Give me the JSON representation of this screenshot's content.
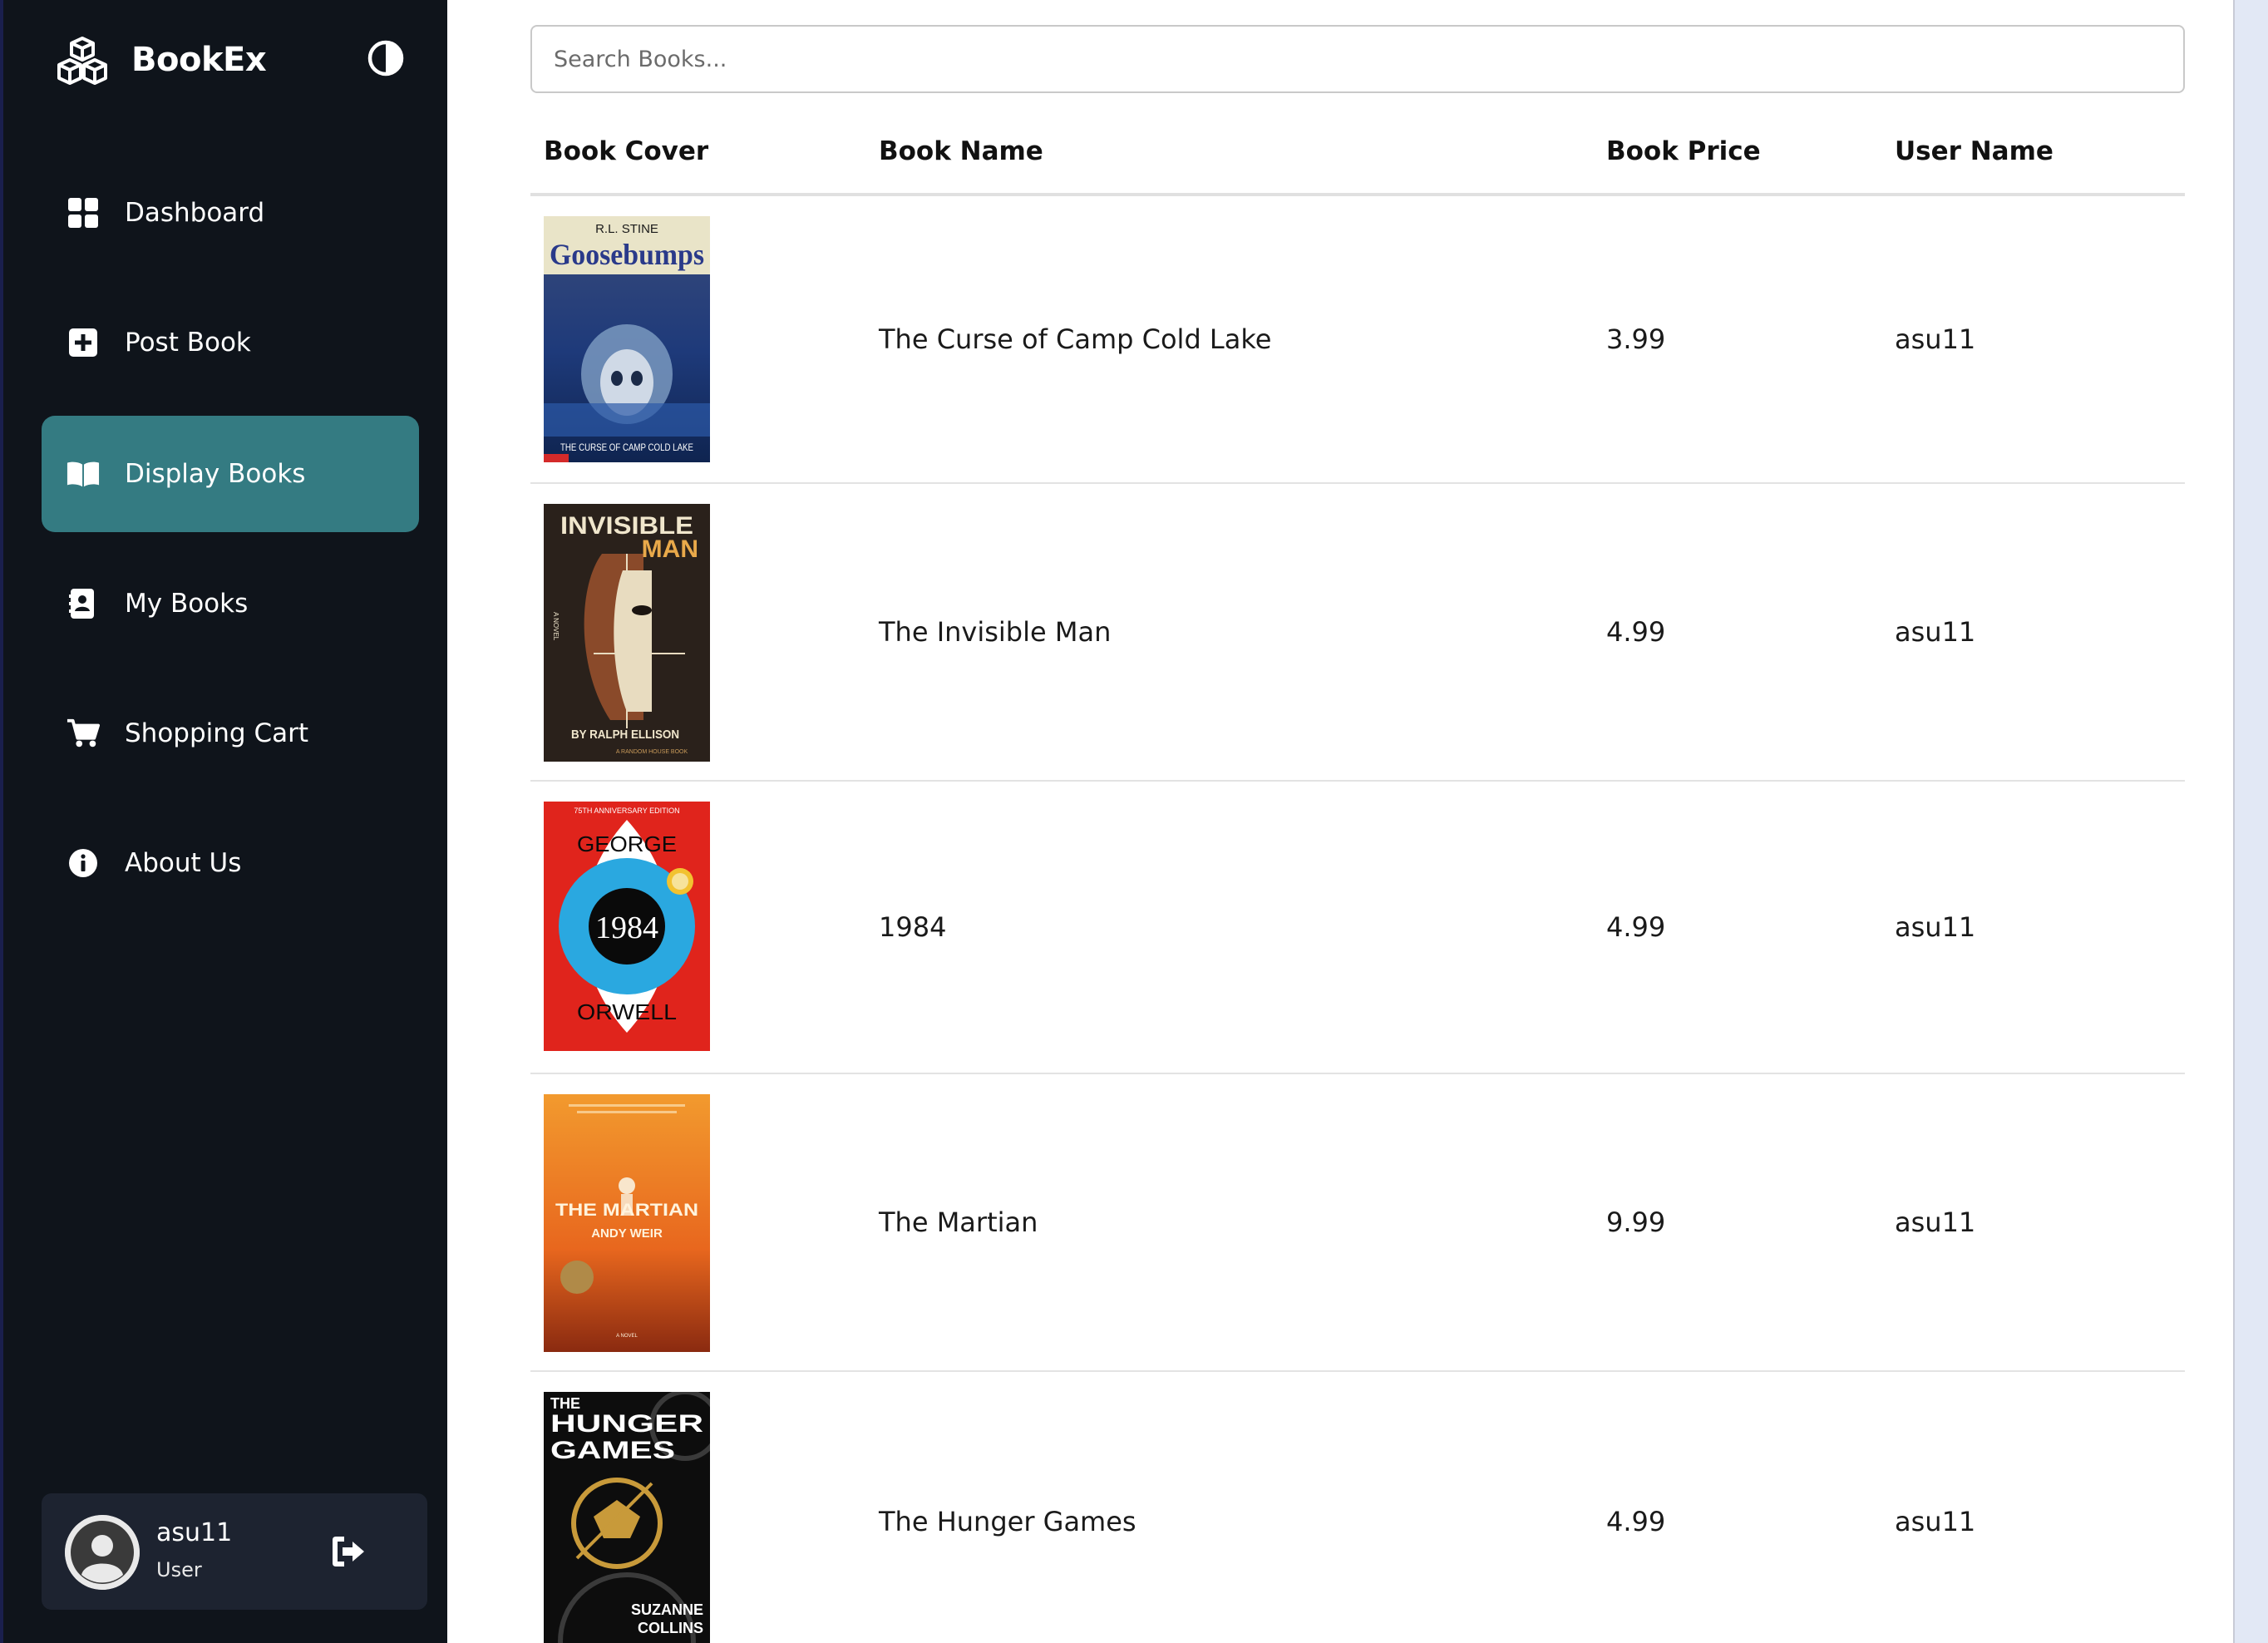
{
  "brand": {
    "name": "BookEx",
    "icon": "cubes-icon"
  },
  "theme_toggle": {
    "icon": "contrast-icon"
  },
  "nav": [
    {
      "label": "Dashboard",
      "icon": "grid-icon",
      "active": false
    },
    {
      "label": "Post Book",
      "icon": "plus-square-icon",
      "active": false
    },
    {
      "label": "Display Books",
      "icon": "open-book-icon",
      "active": true
    },
    {
      "label": "My Books",
      "icon": "address-book-icon",
      "active": false
    },
    {
      "label": "Shopping Cart",
      "icon": "cart-icon",
      "active": false
    },
    {
      "label": "About Us",
      "icon": "info-icon",
      "active": false
    }
  ],
  "user": {
    "name": "asu11",
    "role": "User",
    "logout_icon": "logout-icon"
  },
  "search": {
    "placeholder": "Search Books..."
  },
  "table": {
    "headers": [
      "Book Cover",
      "Book Name",
      "Book Price",
      "User Name"
    ],
    "rows": [
      {
        "cover": {
          "author": "R.L. STINE",
          "title": "Goosebumps",
          "subtitle": "THE CURSE OF CAMP COLD LAKE"
        },
        "name": "The Curse of Camp Cold Lake",
        "price": "3.99",
        "user": "asu11"
      },
      {
        "cover": {
          "title_1": "INVISIBLE",
          "title_2": "MAN",
          "side": "A NOVEL",
          "author": "BY RALPH ELLISON",
          "publisher": "A RANDOM HOUSE BOOK"
        },
        "name": "The Invisible Man",
        "price": "4.99",
        "user": "asu11"
      },
      {
        "cover": {
          "edition": "75TH ANNIVERSARY EDITION",
          "first": "GEORGE",
          "title": "1984",
          "last": "ORWELL"
        },
        "name": "1984",
        "price": "4.99",
        "user": "asu11"
      },
      {
        "cover": {
          "title": "THE MARTIAN",
          "author": "ANDY WEIR",
          "foot": "A NOVEL"
        },
        "name": "The Martian",
        "price": "9.99",
        "user": "asu11"
      },
      {
        "cover": {
          "the": "THE",
          "title_1": "HUNGER",
          "title_2": "GAMES",
          "author_1": "SUZANNE",
          "author_2": "COLLINS"
        },
        "name": "The Hunger Games",
        "price": "4.99",
        "user": "asu11"
      }
    ]
  },
  "colors": {
    "sidebar_bg": "#0f141b",
    "active_nav": "#347b82",
    "user_card_bg": "#1d2330",
    "page_bg": "#e2e8f5"
  }
}
